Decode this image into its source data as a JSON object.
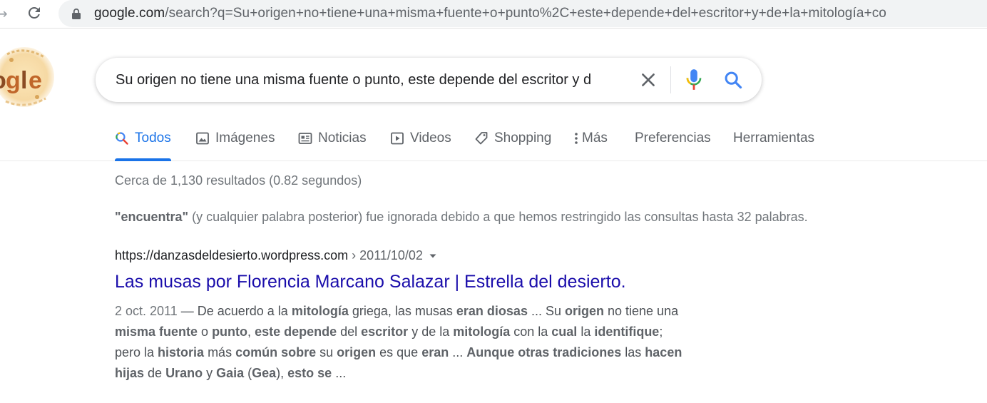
{
  "browser": {
    "url_host": "google.com",
    "url_rest": "/search?q=Su+origen+no+tiene+una+misma+fuente+o+punto%2C+este+depende+del+escritor+y+de+la+mitología+co"
  },
  "search": {
    "query": "Su origen no tiene una misma fuente o punto, este depende del escritor y d"
  },
  "tabs": [
    {
      "label": "Todos",
      "icon": "search-icon",
      "active": true
    },
    {
      "label": "Imágenes",
      "icon": "image-icon"
    },
    {
      "label": "Noticias",
      "icon": "news-icon"
    },
    {
      "label": "Videos",
      "icon": "video-icon"
    },
    {
      "label": "Shopping",
      "icon": "tag-icon"
    },
    {
      "label": "Más",
      "icon": "more-icon"
    },
    {
      "label": "Preferencias"
    },
    {
      "label": "Herramientas"
    }
  ],
  "stats": "Cerca de 1,130 resultados (0.82 segundos)",
  "ignored": {
    "word": "\"encuentra\"",
    "message": " (y cualquier palabra posterior) fue ignorada debido a que hemos restringido las consultas hasta 32 palabras."
  },
  "result": {
    "url": "https://danzasdeldesierto.wordpress.com",
    "breadcrumb": " › 2011/10/02",
    "title": "Las musas por Florencia Marcano Salazar | Estrella del desierto.",
    "date": "2 oct. 2011",
    "snippet_parts": [
      {
        "t": " — De acuerdo a la "
      },
      {
        "t": "mitología",
        "b": true
      },
      {
        "t": " griega, las musas "
      },
      {
        "t": "eran diosas",
        "b": true
      },
      {
        "t": " ... Su "
      },
      {
        "t": "origen",
        "b": true
      },
      {
        "t": " no tiene una "
      },
      {
        "t": "misma fuente",
        "b": true
      },
      {
        "t": " o "
      },
      {
        "t": "punto",
        "b": true
      },
      {
        "t": ", "
      },
      {
        "t": "este depende",
        "b": true
      },
      {
        "t": " del "
      },
      {
        "t": "escritor",
        "b": true
      },
      {
        "t": " y de la "
      },
      {
        "t": "mitología",
        "b": true
      },
      {
        "t": " con la "
      },
      {
        "t": "cual",
        "b": true
      },
      {
        "t": " la "
      },
      {
        "t": "identifique",
        "b": true
      },
      {
        "t": "; pero la "
      },
      {
        "t": "historia",
        "b": true
      },
      {
        "t": " más "
      },
      {
        "t": "común sobre",
        "b": true
      },
      {
        "t": " su "
      },
      {
        "t": "origen",
        "b": true
      },
      {
        "t": " es que "
      },
      {
        "t": "eran",
        "b": true
      },
      {
        "t": " ... "
      },
      {
        "t": "Aunque otras tradiciones",
        "b": true
      },
      {
        "t": " las "
      },
      {
        "t": "hacen hijas",
        "b": true
      },
      {
        "t": " de "
      },
      {
        "t": "Urano",
        "b": true
      },
      {
        "t": " y "
      },
      {
        "t": "Gaia",
        "b": true
      },
      {
        "t": " ("
      },
      {
        "t": "Gea",
        "b": true
      },
      {
        "t": "), "
      },
      {
        "t": "esto se",
        "b": true
      },
      {
        "t": " ..."
      }
    ]
  },
  "colors": {
    "link": "#1a0dab",
    "accent": "#1a73e8",
    "muted": "#70757a"
  }
}
